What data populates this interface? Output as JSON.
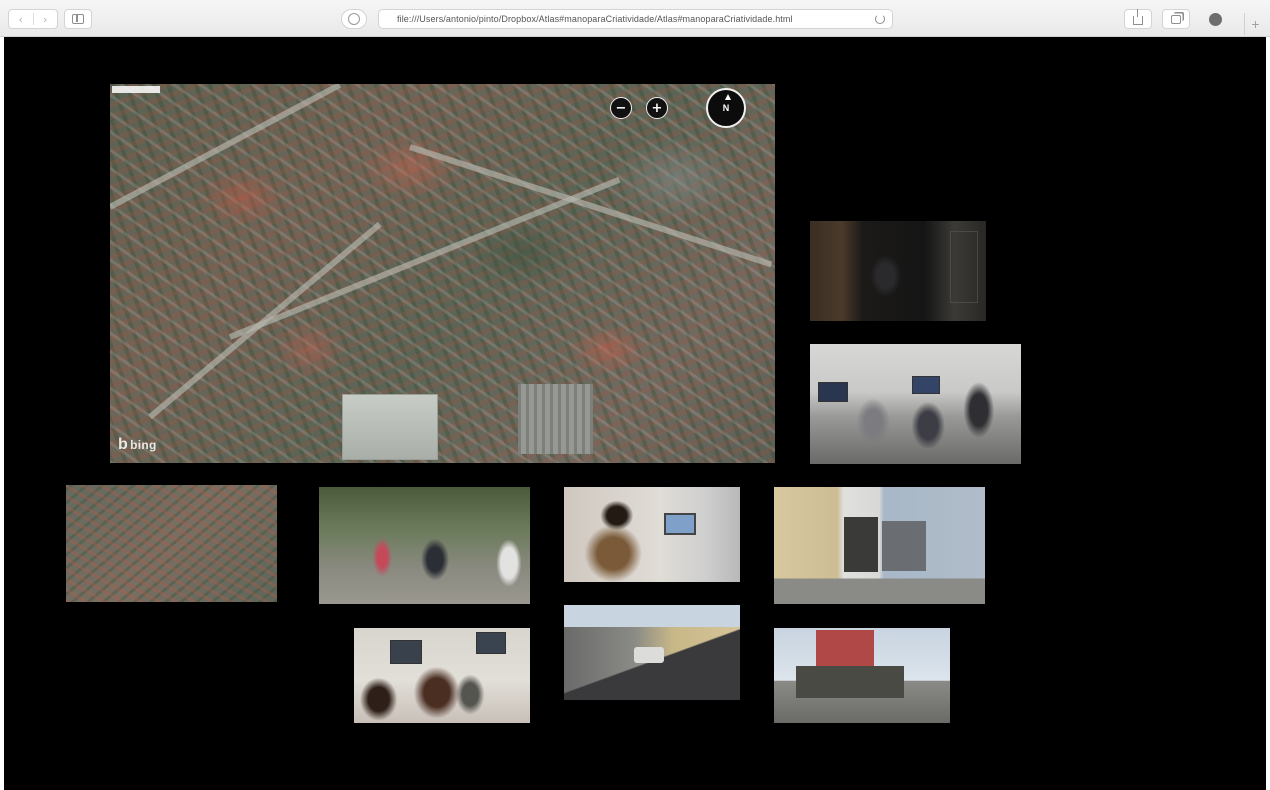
{
  "browser": {
    "address_url": "file:///Users/antonio/pinto/Dropbox/Atlas#manoparaCriatividade/Atlas#manoparaCriatividade.html",
    "nav_back_glyph": "‹",
    "nav_forward_glyph": "›",
    "new_tab_glyph": "+"
  },
  "map": {
    "zoom_out_glyph": "−",
    "zoom_in_glyph": "+",
    "compass_label": "N",
    "logo_text": "bing",
    "logo_glyph": "b"
  },
  "icons": [
    "back-icon",
    "forward-icon",
    "sidebar-icon",
    "privacy-icon",
    "reload-icon",
    "share-icon",
    "tabs-icon",
    "extension-icon",
    "plus-icon",
    "zoom-out-icon",
    "zoom-in-icon",
    "compass-icon"
  ],
  "colors": {
    "page_background": "#000000",
    "toolbar_background": "#eeeeee",
    "map_control": "#111111"
  }
}
